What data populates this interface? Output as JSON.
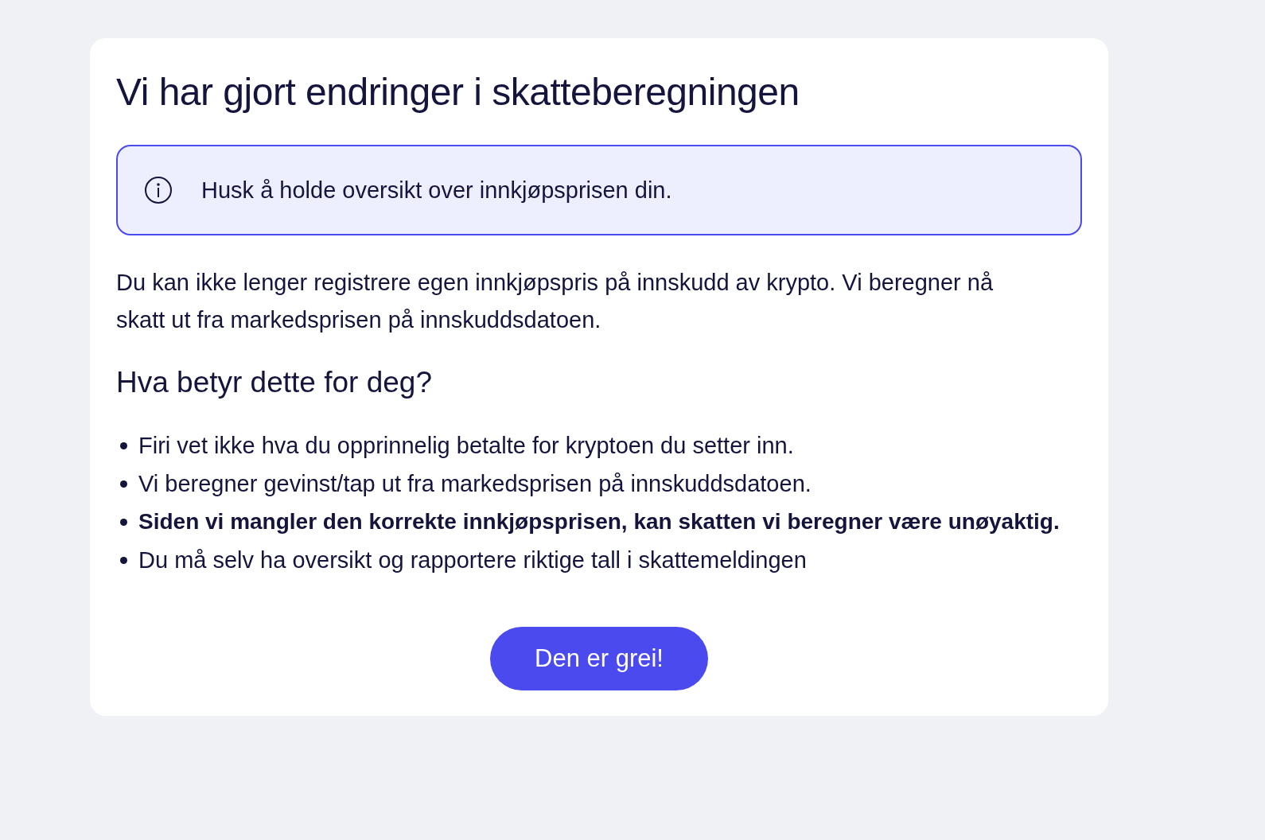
{
  "title": "Vi har gjort endringer i skatteberegningen",
  "notice": {
    "text": "Husk å holde oversikt over innkjøpsprisen din."
  },
  "paragraph": "Du kan ikke lenger registrere egen innkjøpspris på innskudd av krypto. Vi beregner nå skatt ut fra markedsprisen på innskuddsdatoen.",
  "subheading": "Hva betyr dette for deg?",
  "bullets": [
    {
      "text": "Firi vet ikke hva du opprinnelig betalte for kryptoen du setter inn.",
      "bold": false
    },
    {
      "text": "Vi beregner gevinst/tap ut fra markedsprisen på innskuddsdatoen.",
      "bold": false
    },
    {
      "text": "Siden vi mangler den korrekte innkjøpsprisen, kan skatten vi beregner være unøyaktig.",
      "bold": true
    },
    {
      "text": "Du må selv ha oversikt og rapportere riktige tall i skattemeldingen",
      "bold": false
    }
  ],
  "button": "Den er grei!"
}
